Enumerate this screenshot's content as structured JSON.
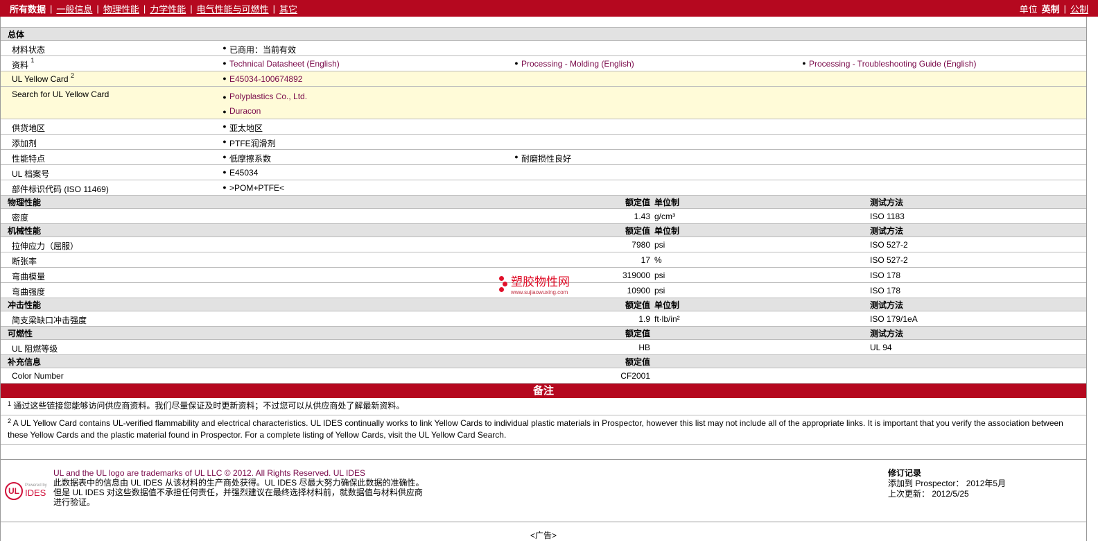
{
  "nav": {
    "items": [
      "所有数据",
      "一般信息",
      "物理性能",
      "力学性能",
      "电气性能与可燃性",
      "其它"
    ],
    "unit_label": "单位",
    "unit_current": "英制",
    "unit_other": "公制"
  },
  "general": {
    "title": "总体",
    "rows": [
      {
        "label": "材料状态",
        "values": [
          "已商用：当前有效"
        ]
      },
      {
        "label": "资料",
        "sup": "1",
        "links": [
          "Technical Datasheet (English)",
          "Processing - Molding (English)",
          "Processing - Troubleshooting Guide (English)"
        ]
      },
      {
        "label": "UL Yellow Card",
        "sup": "2",
        "links": [
          "E45034-100674892"
        ]
      },
      {
        "label": "Search for UL Yellow Card",
        "links": [
          "Polyplastics Co., Ltd.",
          "Duracon"
        ]
      },
      {
        "label": "供货地区",
        "values": [
          "亚太地区"
        ]
      },
      {
        "label": "添加剂",
        "values": [
          "PTFE润滑剂"
        ]
      },
      {
        "label": "性能特点",
        "values": [
          "低摩擦系数",
          "耐磨损性良好"
        ]
      },
      {
        "label": "UL 档案号",
        "values": [
          "E45034"
        ]
      },
      {
        "label": "部件标识代码  (ISO 11469)",
        "values": [
          ">POM+PTFE<"
        ]
      }
    ]
  },
  "headers": {
    "value": "额定值",
    "unit": "单位制",
    "method": "测试方法"
  },
  "sections": [
    {
      "title": "物理性能",
      "rows": [
        {
          "name": "密度",
          "value": "1.43",
          "unit": "g/cm³",
          "method": "ISO 1183"
        }
      ]
    },
    {
      "title": "机械性能",
      "rows": [
        {
          "name": "拉伸应力（屈服）",
          "value": "7980",
          "unit": "psi",
          "method": "ISO 527-2"
        },
        {
          "name": "断张率",
          "value": "17",
          "unit": "%",
          "method": "ISO 527-2"
        },
        {
          "name": "弯曲模量",
          "value": "319000",
          "unit": "psi",
          "method": "ISO 178"
        },
        {
          "name": "弯曲强度",
          "value": "10900",
          "unit": "psi",
          "method": "ISO 178"
        }
      ]
    },
    {
      "title": "冲击性能",
      "rows": [
        {
          "name": "简支梁缺口冲击强度",
          "value": "1.9",
          "unit": "ft·lb/in²",
          "method": "ISO 179/1eA"
        }
      ]
    },
    {
      "title": "可燃性",
      "rows": [
        {
          "name": "UL 阻燃等级",
          "value": "HB",
          "unit": "",
          "method": "UL 94"
        }
      ]
    },
    {
      "title": "补充信息",
      "rows": [
        {
          "name": "Color Number",
          "value": "CF2001",
          "unit": "",
          "method": ""
        }
      ]
    }
  ],
  "watermark": {
    "text": "塑胶物性网",
    "url": "www.sujiaowuxing.com"
  },
  "notes": {
    "title": "备注",
    "items": [
      {
        "num": "1",
        "text": "通过这些链接您能够访问供应商资料。我们尽量保证及时更新资料；不过您可以从供应商处了解最新资料。"
      },
      {
        "num": "2",
        "text": "A UL Yellow Card contains UL-verified flammability and electrical characteristics. UL IDES continually works to link Yellow Cards to individual plastic materials in Prospector, however this list may not include all of the appropriate links. It is important that you verify the association between these Yellow Cards and the plastic material found in Prospector. For a complete listing of Yellow Cards, visit the UL Yellow Card Search."
      }
    ]
  },
  "footer": {
    "logo_powered": "Powered by",
    "logo_ides": "IDES",
    "logo_ul": "UL",
    "line1": "UL and the UL logo are trademarks of UL LLC © 2012. All Rights Reserved. UL IDES",
    "line2": "此数据表中的信息由 UL IDES 从该材料的生产商处获得。UL IDES 尽最大努力确保此数据的准确性。但是 UL IDES 对这些数据值不承担任何责任，并强烈建议在最终选择材料前，就数据值与材料供应商进行验证。",
    "rev_title": "修订记录",
    "rev_added": "添加到  Prospector：   2012年5月",
    "rev_updated": "上次更新：   2012/5/25",
    "ad": "<广告>"
  }
}
